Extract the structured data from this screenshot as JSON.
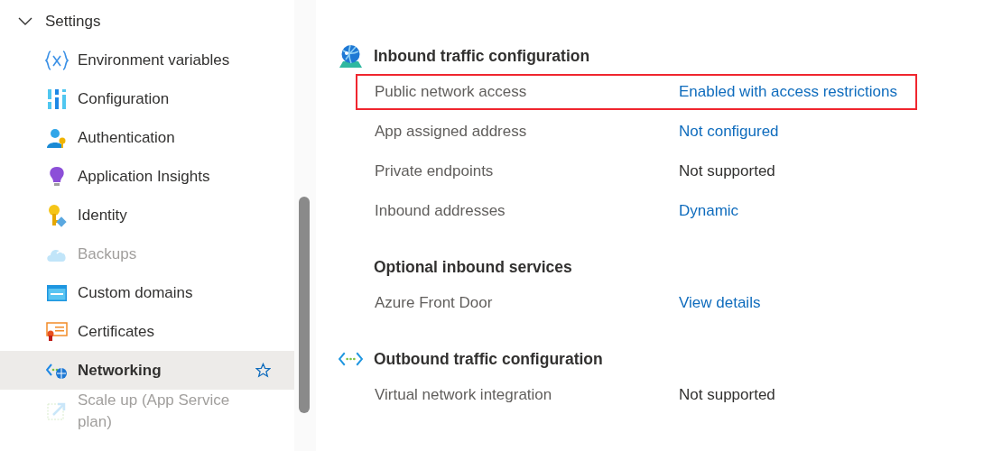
{
  "sidebar": {
    "group": {
      "label": "Settings",
      "expanded": true
    },
    "items": [
      {
        "label": "Environment variables",
        "kind": "variables",
        "disabled": false,
        "selected": false
      },
      {
        "label": "Configuration",
        "kind": "configuration",
        "disabled": false,
        "selected": false
      },
      {
        "label": "Authentication",
        "kind": "authentication",
        "disabled": false,
        "selected": false
      },
      {
        "label": "Application Insights",
        "kind": "insights",
        "disabled": false,
        "selected": false
      },
      {
        "label": "Identity",
        "kind": "identity",
        "disabled": false,
        "selected": false
      },
      {
        "label": "Backups",
        "kind": "backups",
        "disabled": true,
        "selected": false
      },
      {
        "label": "Custom domains",
        "kind": "domains",
        "disabled": false,
        "selected": false
      },
      {
        "label": "Certificates",
        "kind": "certificates",
        "disabled": false,
        "selected": false
      },
      {
        "label": "Networking",
        "kind": "networking",
        "disabled": false,
        "selected": true
      },
      {
        "label": "Scale up (App Service plan)",
        "kind": "scale",
        "disabled": true,
        "selected": false
      }
    ]
  },
  "sections": [
    {
      "title": "Inbound traffic configuration",
      "kind": "inbound",
      "rows": [
        {
          "label": "Public network access",
          "value": "Enabled with access restrictions",
          "kind": "link",
          "highlighted": true
        },
        {
          "label": "App assigned address",
          "value": "Not configured",
          "kind": "link",
          "highlighted": false
        },
        {
          "label": "Private endpoints",
          "value": "Not supported",
          "kind": "text",
          "highlighted": false
        },
        {
          "label": "Inbound addresses",
          "value": "Dynamic",
          "kind": "link",
          "highlighted": false
        }
      ]
    },
    {
      "title": "Optional inbound services",
      "kind": "none",
      "rows": [
        {
          "label": "Azure Front Door",
          "value": "View details",
          "kind": "link",
          "highlighted": false
        }
      ]
    },
    {
      "title": "Outbound traffic configuration",
      "kind": "outbound",
      "rows": [
        {
          "label": "Virtual network integration",
          "value": "Not supported",
          "kind": "text",
          "highlighted": false
        }
      ]
    }
  ]
}
